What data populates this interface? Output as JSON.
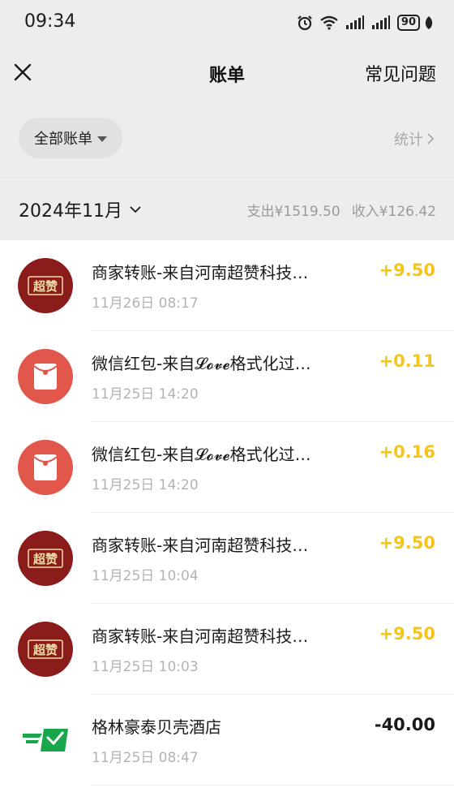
{
  "status_bar": {
    "time": "09:34",
    "battery": "90",
    "icons": [
      "alarm-icon",
      "wifi-icon",
      "signal-icon",
      "signal-icon",
      "battery-icon",
      "leaf-icon"
    ]
  },
  "nav": {
    "title": "账单",
    "faq_label": "常见问题",
    "close_icon": "close-icon"
  },
  "filter": {
    "label": "全部账单",
    "stats_label": "统计"
  },
  "month": {
    "label": "2024年11月",
    "expense": "支出¥1519.50",
    "income": "收入¥126.42"
  },
  "colors": {
    "income": "#f4c51c",
    "expense": "#1a1a1a",
    "merchant_avatar": "#8a1c1c",
    "red_packet_avatar": "#e2574c",
    "hotel_logo": "#1aa64b"
  },
  "transactions": [
    {
      "icon": "merchant-logo",
      "logo_text": "超赞",
      "title": "商家转账-来自河南超赞科技…",
      "time": "11月26日 08:17",
      "amount": "+9.50",
      "direction": "in"
    },
    {
      "icon": "red-packet-icon",
      "title": "微信红包-来自𝓛𝓸𝓿𝓮格式化过…",
      "time": "11月25日 14:20",
      "amount": "+0.11",
      "direction": "in"
    },
    {
      "icon": "red-packet-icon",
      "title": "微信红包-来自𝓛𝓸𝓿𝓮格式化过…",
      "time": "11月25日 14:20",
      "amount": "+0.16",
      "direction": "in"
    },
    {
      "icon": "merchant-logo",
      "logo_text": "超赞",
      "title": "商家转账-来自河南超赞科技…",
      "time": "11月25日 10:04",
      "amount": "+9.50",
      "direction": "in"
    },
    {
      "icon": "merchant-logo",
      "logo_text": "超赞",
      "title": "商家转账-来自河南超赞科技…",
      "time": "11月25日 10:03",
      "amount": "+9.50",
      "direction": "in"
    },
    {
      "icon": "hotel-logo",
      "title": "格林豪泰贝壳酒店",
      "time": "11月25日 08:47",
      "amount": "-40.00",
      "direction": "out"
    }
  ]
}
